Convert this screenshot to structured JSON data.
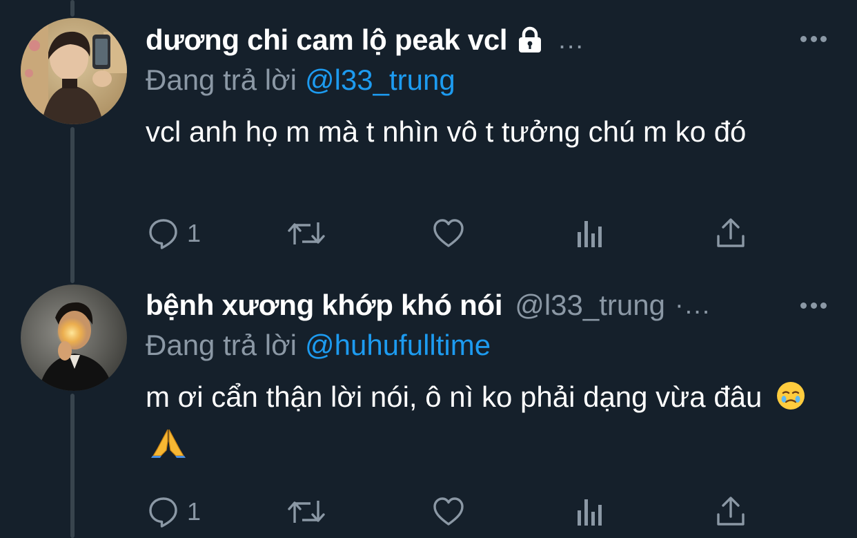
{
  "theme": {
    "background": "#15202b",
    "text_primary": "#ffffff",
    "text_secondary": "#8b98a5",
    "link": "#1d9bf0",
    "thread_line": "#38444d"
  },
  "tweets": [
    {
      "display_name": "dương chi cam lộ peak vcl",
      "protected": true,
      "handle": "",
      "meta_dots": "...",
      "reply_prefix": "Đang trả lời",
      "reply_to": "@l33_trung",
      "text": "vcl anh họ m mà t nhìn vô t tưởng chú m ko đó",
      "emojis": [],
      "reply_count": "1",
      "icons": [
        "reply-icon",
        "retweet-icon",
        "like-icon",
        "analytics-icon",
        "share-icon"
      ]
    },
    {
      "display_name": "bệnh xương khớp khó nói",
      "protected": false,
      "handle": "@l33_trung",
      "meta_dots": "·...",
      "reply_prefix": "Đang trả lời",
      "reply_to": "@huhufulltime",
      "text": "m ơi cẩn thận lời nói, ô nì ko phải dạng vừa đâu",
      "emojis": [
        "face-holding-back-tears-emoji",
        "folded-hands-emoji"
      ],
      "reply_count": "1",
      "icons": [
        "reply-icon",
        "retweet-icon",
        "like-icon",
        "analytics-icon",
        "share-icon"
      ]
    }
  ]
}
